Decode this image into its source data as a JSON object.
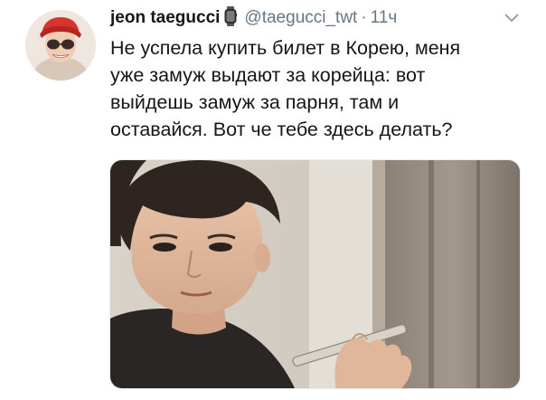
{
  "tweet": {
    "name": "jeon taegucci",
    "handle": "@taegucci_twt",
    "separator": "·",
    "time": "11ч",
    "lines": [
      "Не успела купить билет в Корею, меня",
      "уже замуж выдают за корейца: вот",
      "выйдешь замуж за парня, там и",
      "оставайся. Вот че тебе здесь делать?"
    ]
  },
  "icons": {
    "badge": "watch-icon",
    "menu": "chevron-down-icon"
  },
  "colors": {
    "text": "#14171a",
    "secondary": "#657786",
    "border": "#e6ecf0",
    "background": "#ffffff"
  }
}
